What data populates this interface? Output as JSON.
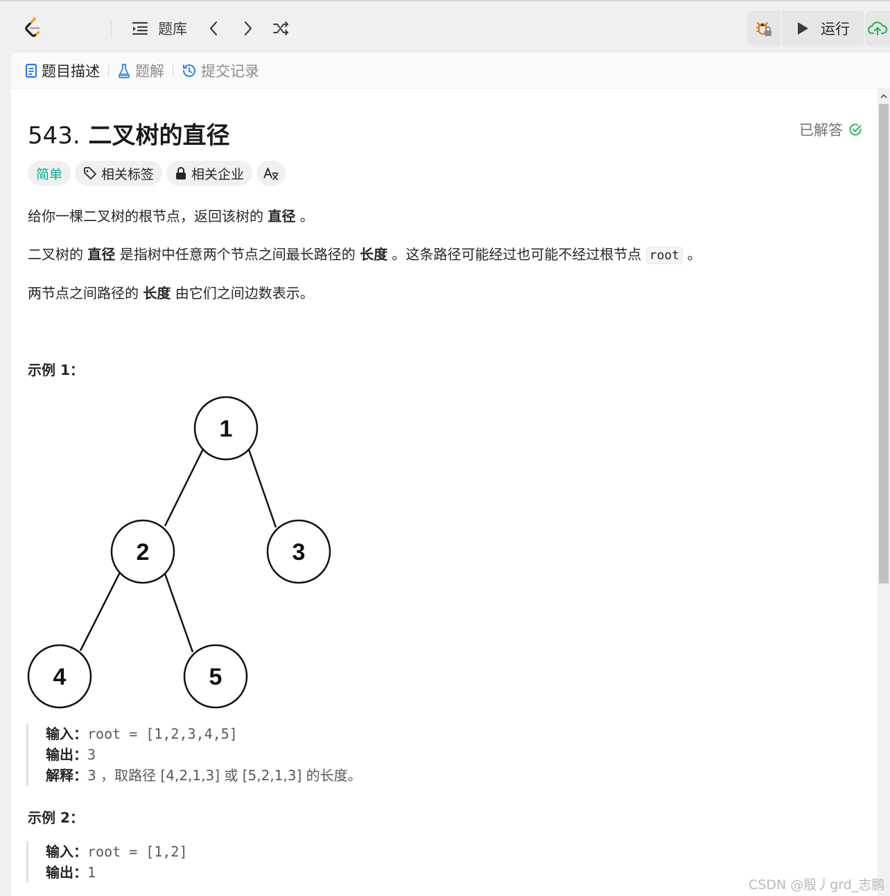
{
  "topbar": {
    "problems_label": "题库",
    "run_label": "运行"
  },
  "tabs": {
    "description": "题目描述",
    "solutions": "题解",
    "submissions": "提交记录"
  },
  "problem": {
    "number": "543.",
    "title": "二叉树的直径",
    "status": "已解答",
    "difficulty": "简单",
    "tags_label": "相关标签",
    "companies_label": "相关企业"
  },
  "description": {
    "p1_a": "给你一棵二叉树的根节点，返回该树的 ",
    "p1_b": "直径",
    "p1_c": " 。",
    "p2_a": "二叉树的 ",
    "p2_b": "直径",
    "p2_c": " 是指树中任意两个节点之间最长路径的 ",
    "p2_d": "长度",
    "p2_e": " 。这条路径可能经过也可能不经过根节点 ",
    "p2_code": "root",
    "p2_f": " 。",
    "p3_a": "两节点之间路径的 ",
    "p3_b": "长度",
    "p3_c": " 由它们之间边数表示。"
  },
  "example1": {
    "heading": "示例 1：",
    "tree_nodes": [
      "1",
      "2",
      "3",
      "4",
      "5"
    ],
    "input_label": "输入：",
    "input": "root = [1,2,3,4,5]",
    "output_label": "输出：",
    "output": "3",
    "explain_label": "解释：",
    "explain_a": "3 ，取路径 [4,2,1,3] 或 [5,2,1,3] 的长度。"
  },
  "example2": {
    "heading": "示例 2：",
    "input_label": "输入：",
    "input": "root = [1,2]",
    "output_label": "输出：",
    "output": "1"
  },
  "watermark": "CSDN @殷丿grd_志鹏",
  "colors": {
    "easy": "#00af9b",
    "solved": "#2db55d",
    "logo_orange": "#ffa116"
  }
}
